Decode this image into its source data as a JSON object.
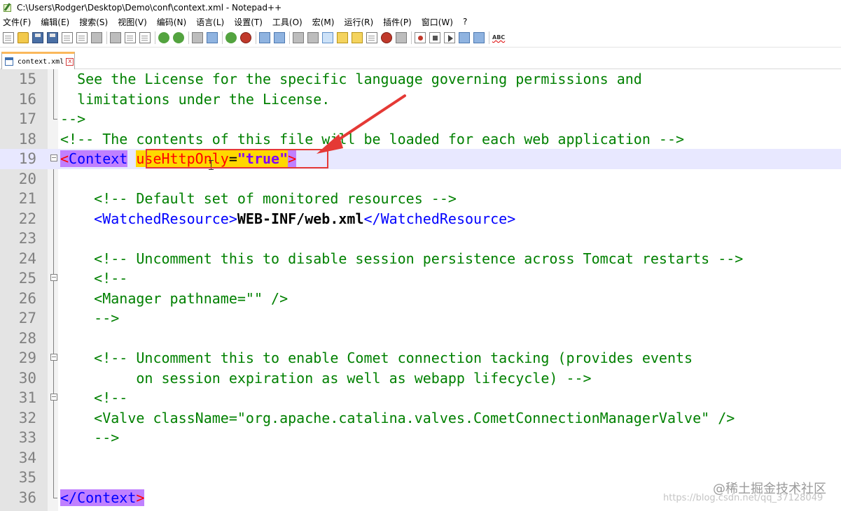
{
  "window": {
    "title": "C:\\Users\\Rodger\\Desktop\\Demo\\conf\\context.xml - Notepad++"
  },
  "menu": [
    "文件(F)",
    "编辑(E)",
    "搜索(S)",
    "视图(V)",
    "编码(N)",
    "语言(L)",
    "设置(T)",
    "工具(O)",
    "宏(M)",
    "运行(R)",
    "插件(P)",
    "窗口(W)",
    "?"
  ],
  "toolbar": {
    "spellcheck_label": "ABC"
  },
  "tab": {
    "label": "context.xml",
    "close": "x"
  },
  "editor": {
    "line_numbers": [
      "15",
      "16",
      "17",
      "18",
      "19",
      "20",
      "21",
      "22",
      "23",
      "24",
      "25",
      "26",
      "27",
      "28",
      "29",
      "30",
      "31",
      "32",
      "33",
      "34",
      "35",
      "36"
    ],
    "lines": {
      "l15": "  See the License for the specific language governing permissions and",
      "l16": "  limitations under the License.",
      "l17": "-->",
      "l18": "<!-- The contents of this file will be loaded for each web application -->",
      "l19_open": "<",
      "l19_tag": "Context",
      "l19_attr": "useHttpOnly",
      "l19_eq": "=",
      "l19_val": "\"true\"",
      "l19_close": ">",
      "l21": "    <!-- Default set of monitored resources -->",
      "l22_open": "    <WatchedResource>",
      "l22_text": "WEB-INF/web.xml",
      "l22_close": "</WatchedResource>",
      "l24": "    <!-- Uncomment this to disable session persistence across Tomcat restarts -->",
      "l25": "    <!--",
      "l26": "    <Manager pathname=\"\" />",
      "l27": "    -->",
      "l29": "    <!-- Uncomment this to enable Comet connection tacking (provides events",
      "l30": "         on session expiration as well as webapp lifecycle) -->",
      "l31": "    <!--",
      "l32": "    <Valve className=\"org.apache.catalina.valves.CometConnectionManagerValve\" />",
      "l33": "    -->",
      "l36_open": "</",
      "l36_tag": "Context",
      "l36_close": ">"
    }
  },
  "annotation": {
    "box_color": "#e53935"
  },
  "watermark": {
    "main": "@稀土掘金技术社区",
    "url": "https://blog.csdn.net/qq_37128049"
  }
}
